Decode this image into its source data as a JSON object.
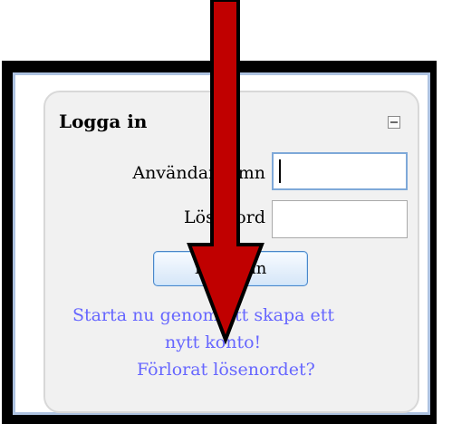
{
  "login_block": {
    "title": "Logga in",
    "username_label": "Användarnamn",
    "password_label": "Lösenord",
    "username_value": "",
    "password_value": "",
    "submit_label": "Logga in",
    "create_account_line1": "Starta nu genom att skapa ett",
    "create_account_line2": "nytt konto!",
    "forgot_password": "Förlorat lösenordet?"
  },
  "icons": {
    "collapse": "collapse-minus-icon",
    "annotation": "red-down-arrow-icon"
  },
  "colors": {
    "arrow": "#c00000",
    "link": "#6666ff",
    "frame_border": "#000000",
    "inner_border": "#adc2e0",
    "box_background": "#f1f1f1",
    "button_border": "#4b86c8"
  }
}
